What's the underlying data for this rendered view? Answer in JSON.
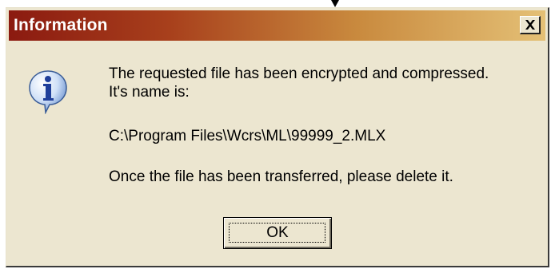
{
  "dialog": {
    "title": "Information",
    "close_icon": "close-icon",
    "icon": "info-icon",
    "messages": {
      "line1": "The requested file has been encrypted and compressed.",
      "line2": "It's name is:",
      "path": "C:\\Program Files\\Wcrs\\ML\\99999_2.MLX",
      "note": "Once the file has been transferred, please delete it."
    },
    "ok_label": "OK"
  },
  "colors": {
    "title_gradient_start": "#8b1a10",
    "title_gradient_end": "#e4c076",
    "dialog_face": "#ece6d0"
  }
}
